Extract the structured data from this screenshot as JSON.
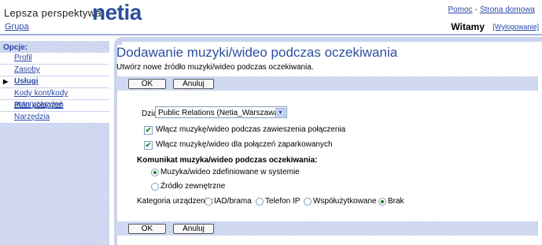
{
  "header": {
    "brand_text": "Lepsza perspektywa",
    "brand_logo": "netia",
    "help_link": "Pomoc",
    "separator": "-",
    "home_link": "Strona domowa",
    "group_link": "Grupa",
    "welcome": "Witamy",
    "logout_link": "[Wylogowanie]"
  },
  "sidebar": {
    "title": "Opcje:",
    "items": [
      {
        "label": "Profil"
      },
      {
        "label": "Zasoby"
      },
      {
        "label": "Usługi"
      },
      {
        "label": "Kody kont/kody autoryzacyjne"
      },
      {
        "label": "Plan połączeń"
      },
      {
        "label": "Narzędzia"
      }
    ]
  },
  "page": {
    "title": "Dodawanie muzyki/wideo podczas oczekiwania",
    "description": "Utwórz nowe źródło muzyki/wideo podczas oczekiwania.",
    "ok_label": "OK",
    "cancel_label": "Anuluj"
  },
  "form": {
    "dept_label": "Dział:",
    "dept_value": "Public Relations (Netia_Warszawa)",
    "hold_checkbox_label": "Włącz muzykę/wideo podczas zawieszenia połączenia",
    "hold_checked": true,
    "park_checkbox_label": "Włącz muzykę/wideo dla połączeń zaparkowanych",
    "park_checked": true,
    "message_heading": "Komunikat muzyka/wideo podczas oczekiwania:",
    "source_options": [
      {
        "label": "Muzyka/wideo zdefiniowane w systemie",
        "selected": true
      },
      {
        "label": "Źródło zewnętrzne",
        "selected": false
      }
    ],
    "category_label": "Kategoria urządzenia:",
    "category_options": [
      {
        "label": "IAD/brama",
        "selected": false
      },
      {
        "label": "Telefon IP",
        "selected": false
      },
      {
        "label": "Współużytkowane",
        "selected": false
      },
      {
        "label": "Brak",
        "selected": true
      }
    ]
  },
  "colors": {
    "accent": "#2d4f9e",
    "link": "#2b48a8",
    "panel": "#c9d3ee"
  }
}
